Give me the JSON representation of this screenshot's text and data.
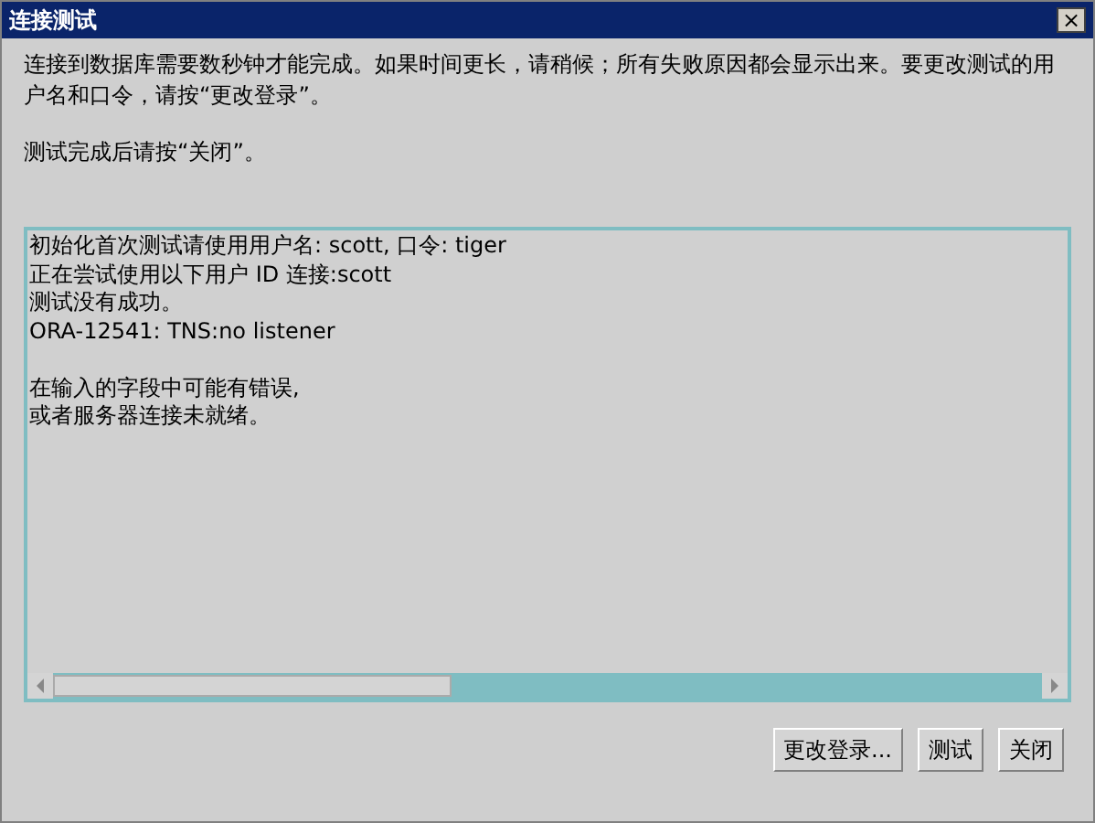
{
  "window": {
    "title": "连接测试",
    "close": "×"
  },
  "intro": [
    "连接到数据库需要数秒钟才能完成。如果时间更长，请稍候；所有失败原因都会显示出来。要更改测试的用户名和口令，请按“更改登录”。",
    "测试完成后请按“关闭”。"
  ],
  "output": [
    [
      "初始化首次测试请使用用户名: scott, 口令: tiger",
      "正在尝试使用以下用户 ID 连接:scott",
      "测试没有成功。",
      "ORA-12541: TNS:no listener"
    ],
    [
      "在输入的字段中可能有错误,",
      "或者服务器连接未就绪。"
    ]
  ],
  "buttons": [
    "更改登录...",
    "测试",
    "关闭"
  ]
}
